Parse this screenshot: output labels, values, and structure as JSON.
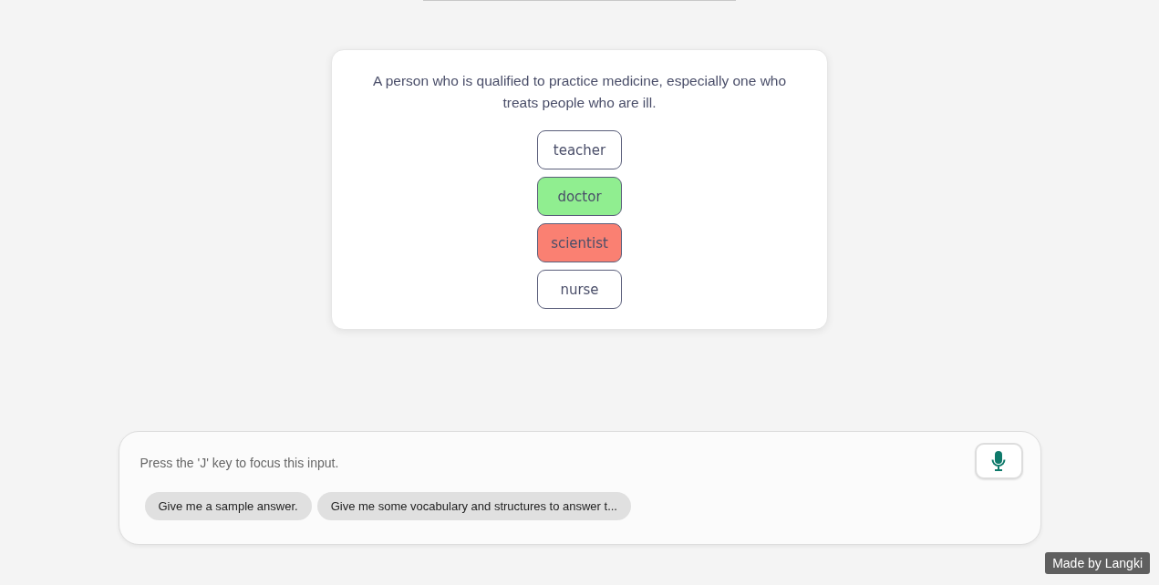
{
  "question": {
    "prompt": "A person who is qualified to practice medicine, especially one who treats people who are ill.",
    "options": [
      {
        "label": "teacher",
        "color": "#ffffff"
      },
      {
        "label": "doctor",
        "color": "#90ee90"
      },
      {
        "label": "scientist",
        "color": "#fa8072"
      },
      {
        "label": "nurse",
        "color": "#ffffff"
      }
    ]
  },
  "input": {
    "placeholder": "Press the 'J' key to focus this input."
  },
  "suggestions": [
    "Give me a sample answer.",
    "Give me some vocabulary and structures to answer t..."
  ],
  "footer_badge": "Made by Langki"
}
